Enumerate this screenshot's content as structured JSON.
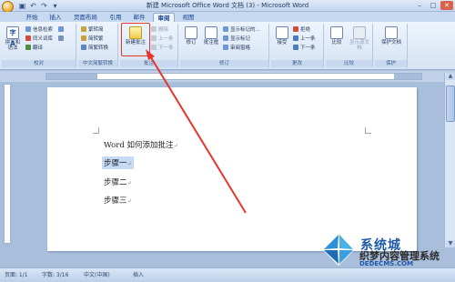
{
  "window": {
    "title": "新建 Microsoft Office Word 文档 (3) - Microsoft Word",
    "controls": [
      "–",
      "□",
      "✕"
    ]
  },
  "qat": [
    "save-icon",
    "undo-icon",
    "redo-icon",
    "dropdown-icon"
  ],
  "tabs": [
    {
      "label": "开始",
      "active": false
    },
    {
      "label": "插入",
      "active": false
    },
    {
      "label": "页面布局",
      "active": false
    },
    {
      "label": "引用",
      "active": false
    },
    {
      "label": "邮件",
      "active": false
    },
    {
      "label": "审阅",
      "active": true
    },
    {
      "label": "视图",
      "active": false
    }
  ],
  "ribbon": {
    "proofing": {
      "label": "校对",
      "big_button": "拼写和语法",
      "items": [
        "信息检索",
        "同义词库",
        "翻译"
      ]
    },
    "chinese_conversion": {
      "label": "中文简繁转换",
      "items": [
        "繁转简",
        "简转繁",
        "简繁转换"
      ]
    },
    "comments": {
      "label": "批注",
      "new_comment": "新建批注",
      "items": [
        "删除",
        "上一条",
        "下一条"
      ]
    },
    "tracking": {
      "label": "修订",
      "buttons": [
        "修订",
        "批注框"
      ],
      "items": [
        "显示标记的...",
        "显示标记",
        "审阅窗格"
      ]
    },
    "changes": {
      "label": "更改",
      "big_button": "接受",
      "items": [
        "拒绝",
        "上一条",
        "下一条"
      ]
    },
    "compare": {
      "label": "比较",
      "buttons": [
        "比较",
        "显示源文档"
      ]
    },
    "protect": {
      "label": "保护",
      "big_button": "保护文档"
    }
  },
  "document": {
    "lines": [
      "Word 如何添加批注",
      "步骤一",
      "步骤二",
      "步骤三"
    ],
    "paragraph_mark": "↵"
  },
  "status_bar": {
    "page": "页面: 1/1",
    "words": "字数: 3/16",
    "language": "中文(中国)",
    "mode": "插入"
  },
  "watermark": {
    "line1": "系统城",
    "line2": "织梦内容管理系统",
    "line3": "DEDECMS.COM"
  },
  "colors": {
    "accent_red": "#e6352b",
    "selection": "#c4daf5",
    "ribbon_bg": "#eef4fc"
  }
}
